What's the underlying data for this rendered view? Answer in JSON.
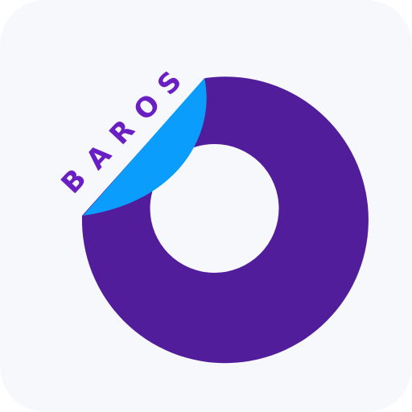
{
  "app": {
    "brand_letters": [
      "B",
      "A",
      "R",
      "O",
      "S"
    ]
  },
  "icons": {
    "logo": "baros-ring-logo-icon",
    "peel": "peeled-corner-icon"
  },
  "colors": {
    "tile_background": "#f6f8fb",
    "ring": "#521d9b",
    "peel": "#0b9dfb",
    "brand_text": "#6a1fc4"
  }
}
